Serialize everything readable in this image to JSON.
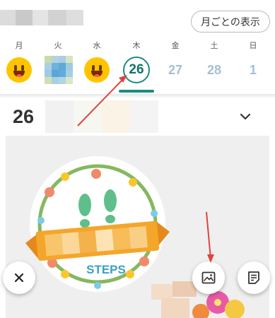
{
  "header": {
    "month_view_button": "月ごとの表示"
  },
  "week": {
    "days": [
      {
        "dow": "月",
        "kind": "smiley"
      },
      {
        "dow": "火",
        "kind": "photo"
      },
      {
        "dow": "水",
        "kind": "smiley"
      },
      {
        "dow": "木",
        "kind": "today",
        "date": "26"
      },
      {
        "dow": "金",
        "kind": "future",
        "date": "27"
      },
      {
        "dow": "土",
        "kind": "future",
        "date": "28"
      },
      {
        "dow": "日",
        "kind": "future",
        "date": "1"
      }
    ]
  },
  "entry": {
    "date": "26",
    "sticker_text": "STEPS"
  },
  "colors": {
    "accent": "#1a8c83",
    "future_date": "#a7bfd2",
    "annotation_arrow": "#e0433f",
    "smiley": "#ffc400"
  },
  "icons": {
    "close": "close-icon",
    "image": "image-icon",
    "note": "note-icon",
    "expand": "chevron-down-icon"
  }
}
